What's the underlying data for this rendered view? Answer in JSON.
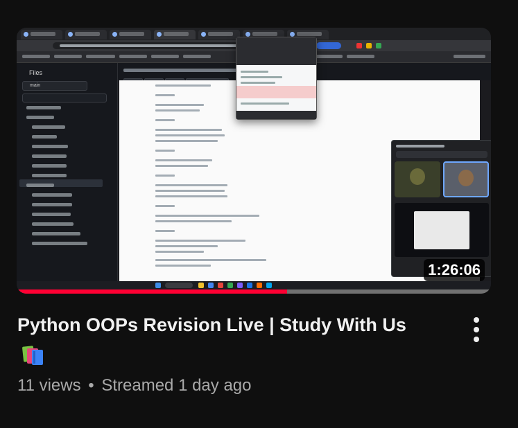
{
  "video": {
    "title": "Python OOPs Revision Live | Study With Us",
    "title_emoji": "books-emoji",
    "duration": "1:26:06",
    "views": "11 views",
    "separator": "•",
    "streamed": "Streamed 1 day ago",
    "watch_progress": 0.57
  },
  "thumbnail": {
    "sidebar_title": "Files",
    "branch": "main"
  },
  "icons": {
    "more": "more-vert-icon"
  },
  "colors": {
    "background": "#0f0f0f",
    "progress": "#ff0033",
    "meta_text": "#aaaaaa"
  }
}
